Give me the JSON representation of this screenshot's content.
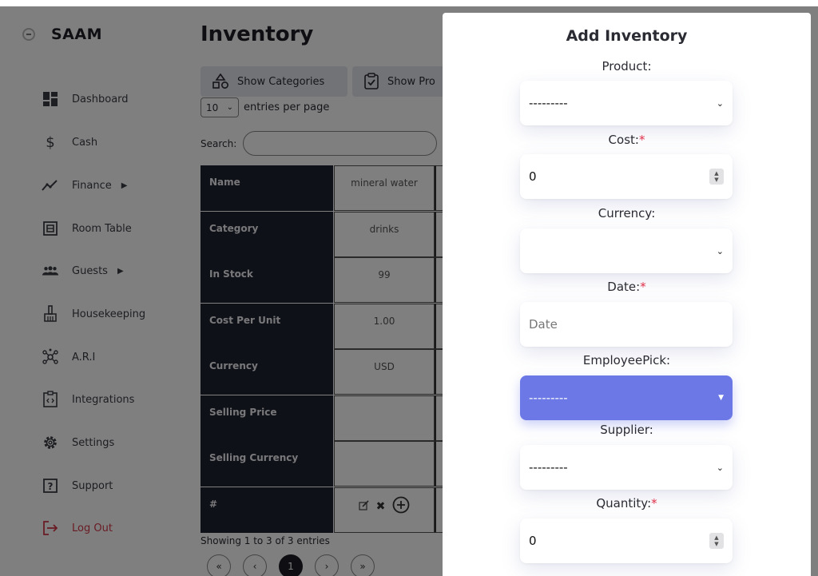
{
  "app": {
    "brand": "SAAM"
  },
  "sidebar": {
    "items": [
      {
        "label": "Dashboard",
        "icon": "dashboard-icon"
      },
      {
        "label": "Cash",
        "icon": "dollar-icon"
      },
      {
        "label": "Finance",
        "icon": "chart-line-icon",
        "has_submenu": true
      },
      {
        "label": "Room Table",
        "icon": "room-table-icon"
      },
      {
        "label": "Guests",
        "icon": "users-icon",
        "has_submenu": true
      },
      {
        "label": "Housekeeping",
        "icon": "broom-icon"
      },
      {
        "label": "A.R.I",
        "icon": "network-icon"
      },
      {
        "label": "Integrations",
        "icon": "integrations-icon"
      },
      {
        "label": "Settings",
        "icon": "gear-icon"
      },
      {
        "label": "Support",
        "icon": "help-icon"
      },
      {
        "label": "Log Out",
        "icon": "logout-icon"
      }
    ]
  },
  "main": {
    "title": "Inventory",
    "buttons": {
      "show_categories": "Show Categories",
      "show_products": "Show Pro"
    },
    "entries": {
      "value": "10",
      "suffix": "entries per page"
    },
    "search_label": "Search:",
    "table": {
      "rows": [
        {
          "header": "Name",
          "value": "mineral water"
        },
        {
          "header": "Category",
          "value": "drinks"
        },
        {
          "header": "In Stock",
          "value": "99"
        },
        {
          "header": "Cost Per Unit",
          "value": "1.00"
        },
        {
          "header": "Currency",
          "value": "USD"
        },
        {
          "header": "Selling Price",
          "value": ""
        },
        {
          "header": "Selling Currency",
          "value": ""
        },
        {
          "header": "#",
          "value": ""
        }
      ]
    },
    "footer": {
      "showing": "Showing 1 to 3 of 3 entries"
    },
    "pagination": {
      "first": "«",
      "prev": "‹",
      "current": "1",
      "next": "›",
      "last": "»"
    }
  },
  "modal": {
    "title": "Add Inventory",
    "fields": {
      "product": {
        "label": "Product:",
        "value": "---------"
      },
      "cost": {
        "label": "Cost:",
        "required": "*",
        "value": "0"
      },
      "currency": {
        "label": "Currency:",
        "value": ""
      },
      "date": {
        "label": "Date:",
        "required": "*",
        "placeholder": "Date"
      },
      "employee": {
        "label": "EmployeePick:",
        "value": "---------"
      },
      "supplier": {
        "label": "Supplier:",
        "value": "---------"
      },
      "quantity": {
        "label": "Quantity:",
        "required": "*",
        "value": "0"
      }
    }
  },
  "colors": {
    "accent": "#6b78e5",
    "dark": "#1f2230",
    "required": "#e0304a",
    "logout": "#d4394a"
  }
}
